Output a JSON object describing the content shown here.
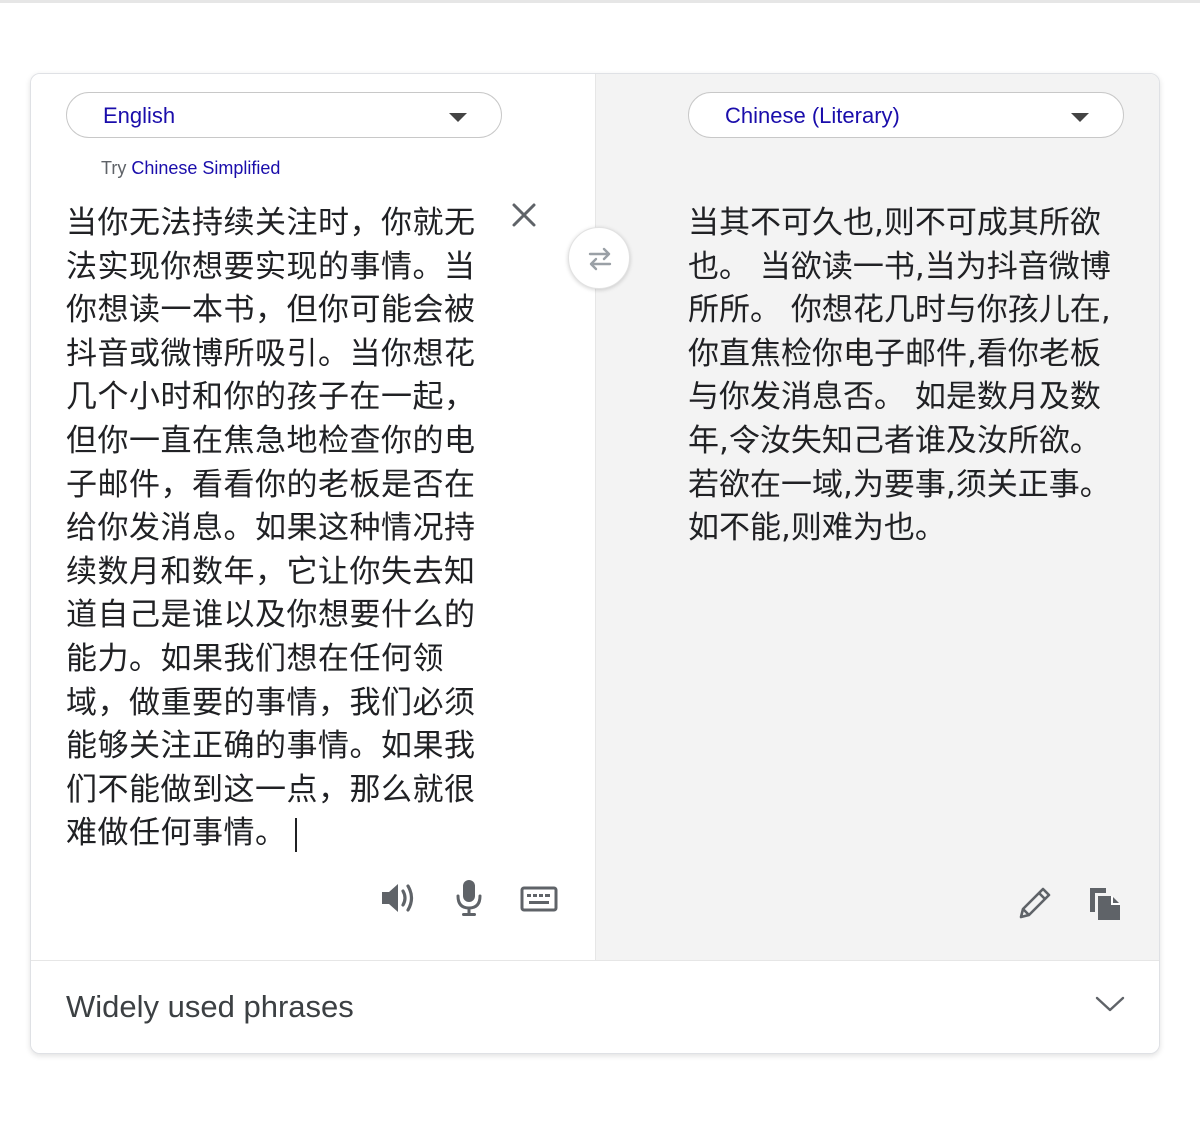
{
  "source": {
    "language": "English",
    "suggestion_prefix": "Try",
    "suggestion_language": "Chinese Simplified",
    "text": "当你无法持续关注时，你就无法实现你想要实现的事情。当你想读一本书，但你可能会被抖音或微博所吸引。当你想花几个小时和你的孩子在一起，但你一直在焦急地检查你的电子邮件，看看你的老板是否在给你发消息。如果这种情况持续数月和数年，它让你失去知道自己是谁以及你想要什么的能力。如果我们想在任何领域，做重要的事情，我们必须能够关注正确的事情。如果我们不能做到这一点，那么就很难做任何事情。"
  },
  "target": {
    "language": "Chinese (Literary)",
    "text": "当其不可久也,则不可成其所欲也。 当欲读一书,当为抖音微博所所。 你想花几时与你孩儿在,你直焦检你电子邮件,看你老板与你发消息否。 如是数月及数年,令汝失知己者谁及汝所欲。若欲在一域,为要事,须关正事。如不能,则难为也。"
  },
  "footer": {
    "phrases_label": "Widely used phrases"
  },
  "icons": {
    "clear": "close-icon",
    "swap": "swap-icon",
    "listen": "speaker-icon",
    "voice": "microphone-icon",
    "keyboard": "keyboard-icon",
    "edit": "pencil-icon",
    "copy": "copy-icon",
    "expand": "chevron-down-icon"
  },
  "colors": {
    "link": "#1a0dab",
    "text": "#202124",
    "icon": "#5f6368",
    "target_background": "#f3f3f3"
  }
}
